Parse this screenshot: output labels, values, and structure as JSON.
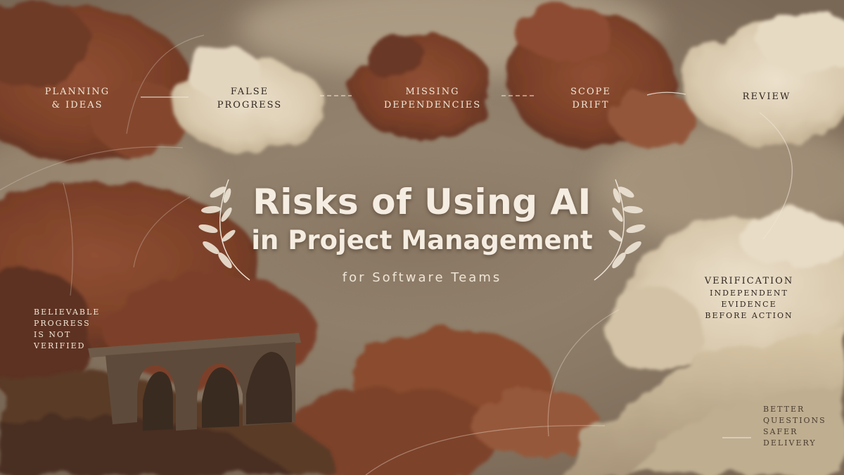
{
  "title": {
    "line1": "Risks of Using AI",
    "line2": "in Project Management",
    "subtitle": "for Software Teams"
  },
  "flow": {
    "planning": [
      "PLANNING",
      "& IDEAS"
    ],
    "false_progress": [
      "FALSE",
      "PROGRESS"
    ],
    "missing_dependencies": [
      "MISSING",
      "DEPENDENCIES"
    ],
    "scope_drift": [
      "SCOPE",
      "DRIFT"
    ],
    "review": [
      "REVIEW"
    ]
  },
  "verification": {
    "heading": "VERIFICATION",
    "lines": [
      "INDEPENDENT",
      "EVIDENCE",
      "BEFORE ACTION"
    ]
  },
  "side_note": [
    "BELIEVABLE",
    "PROGRESS",
    "IS NOT",
    "VERIFIED"
  ],
  "corner_note": [
    "BETTER",
    "QUESTIONS",
    "SAFER",
    "DELIVERY"
  ],
  "icons": [
    "laurel-left-icon",
    "laurel-right-icon"
  ],
  "colors": {
    "rust": "#8a4a2e",
    "cream": "#e8dcc6",
    "sepia_background": "#9a8a75",
    "title_text": "#f5ede1"
  }
}
